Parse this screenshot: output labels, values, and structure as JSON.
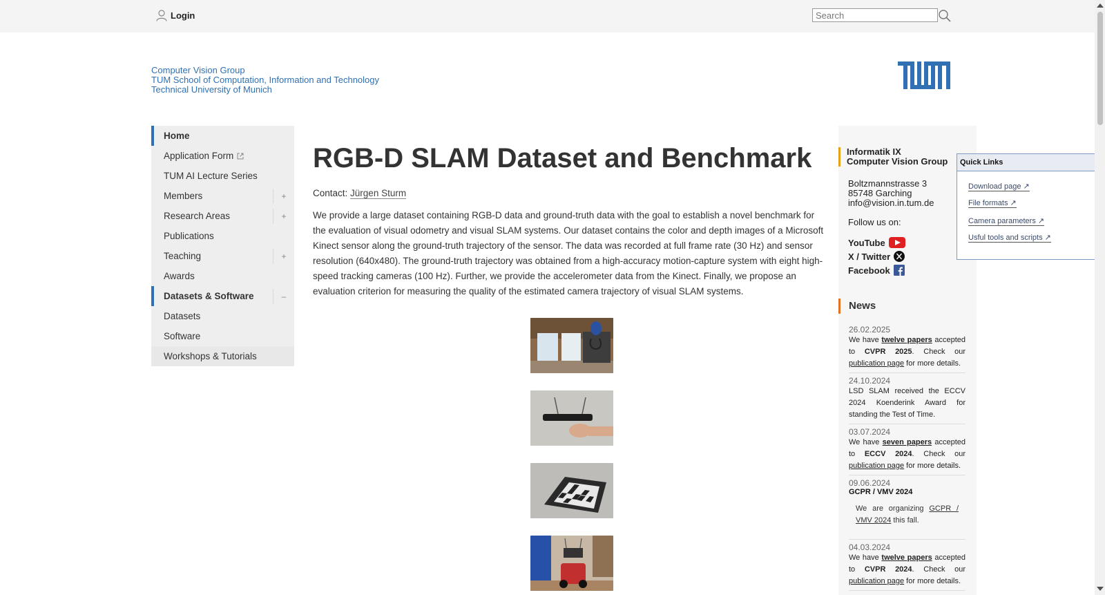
{
  "topbar": {
    "login_label": "Login",
    "search_placeholder": "Search"
  },
  "header": {
    "group": "Computer Vision Group",
    "school": "TUM School of Computation, Information and Technology",
    "university": "Technical University of Munich"
  },
  "nav": {
    "items": [
      {
        "label": "Home"
      },
      {
        "label": "Application Form"
      },
      {
        "label": "TUM AI Lecture Series"
      },
      {
        "label": "Members",
        "toggle": "+"
      },
      {
        "label": "Research Areas",
        "toggle": "+"
      },
      {
        "label": "Publications"
      },
      {
        "label": "Teaching",
        "toggle": "+"
      },
      {
        "label": "Awards"
      },
      {
        "label": "Datasets & Software",
        "toggle": "–"
      },
      {
        "label": "Datasets"
      },
      {
        "label": "Software"
      },
      {
        "label": "Workshops & Tutorials"
      }
    ]
  },
  "main": {
    "title": "RGB-D SLAM Dataset and Benchmark",
    "contact_prefix": "Contact:",
    "contact_name": "Jürgen Sturm",
    "intro": "We provide a large dataset containing RGB-D data and ground-truth data with the goal to establish a novel benchmark for the evaluation of visual odometry and visual SLAM systems. Our dataset contains the color and depth images of a Microsoft Kinect sensor along the ground-truth trajectory of the sensor. The data was recorded at full frame rate (30 Hz) and sensor resolution (640x480). The ground-truth trajectory was obtained from a high-accuracy motion-capture system with eight high-speed tracking cameras (100 Hz). Further, we provide the accelerometer data from the Kinect. Finally, we propose an evaluation criterion for measuring the quality of the estimated camera trajectory of visual SLAM systems."
  },
  "sidebar": {
    "inst_line1": "Informatik IX",
    "inst_line2": "Computer Vision Group",
    "address1": "Boltzmannstrasse 3",
    "address2": "85748 Garching",
    "email": "info@vision.in.tum.de",
    "follow": "Follow us on:",
    "youtube": "YouTube",
    "twitter": "X / Twitter",
    "facebook": "Facebook",
    "news_title": "News",
    "news": [
      {
        "date": "26.02.2025",
        "pre": "We have ",
        "link": "twelve papers",
        "mid": " accepted to ",
        "bold": "CVPR 2025",
        "post": ". Check our ",
        "link2": "publication page",
        "end": " for more details."
      },
      {
        "date": "24.10.2024",
        "text": "LSD SLAM received the ECCV 2024 Koenderink Award for standing the Test of Time."
      },
      {
        "date": "03.07.2024",
        "pre": "We have ",
        "link": "seven papers",
        "mid": " accepted to ",
        "bold": "ECCV 2024",
        "post": ". Check our ",
        "link2": "publication page",
        "end": " for more details."
      },
      {
        "date": "09.06.2024",
        "title": "GCPR / VMV 2024",
        "pre": "We are organizing ",
        "link": "GCPR / VMV 2024",
        "end": " this fall."
      },
      {
        "date": "04.03.2024",
        "pre": "We have ",
        "link": "twelve papers",
        "mid": " accepted to ",
        "bold": "CVPR 2024",
        "post": ". Check our ",
        "link2": "publication page",
        "end": " for more details."
      }
    ]
  },
  "quick_links": {
    "title": "Quick Links",
    "items": [
      "Download page",
      "File formats",
      "Camera parameters",
      "Usful tools and scripts"
    ]
  },
  "colors": {
    "tum_blue": "#3070b3",
    "inst_accent": "#e3a21a",
    "news_accent": "#e37222"
  }
}
